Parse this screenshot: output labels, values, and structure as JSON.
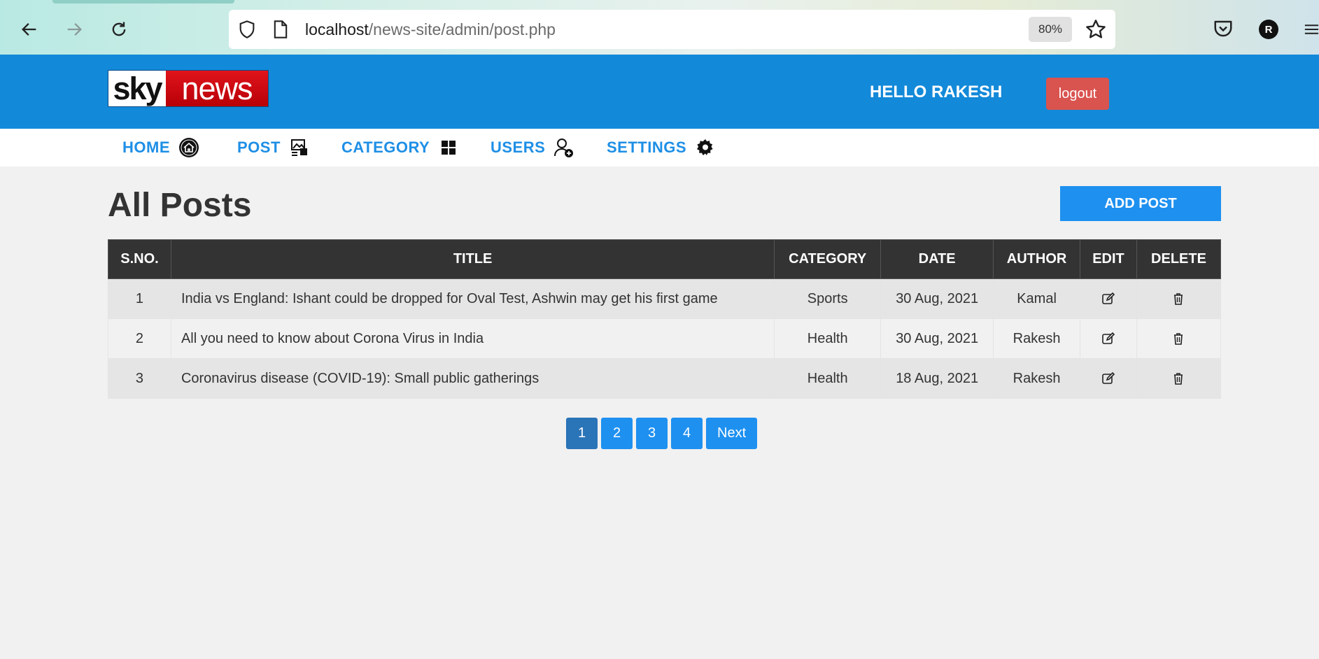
{
  "browser": {
    "url_host": "localhost",
    "url_path": "/news-site/admin/post.php",
    "zoom": "80%",
    "profile_initial": "R"
  },
  "header": {
    "logo_sky": "sky",
    "logo_news": "news",
    "greeting": "HELLO RAKESH",
    "logout_label": "logout"
  },
  "menu": {
    "items": [
      {
        "label": "HOME",
        "icon": "home-icon"
      },
      {
        "label": "POST",
        "icon": "post-icon"
      },
      {
        "label": "CATEGORY",
        "icon": "category-grid-icon"
      },
      {
        "label": "USERS",
        "icon": "user-add-icon"
      },
      {
        "label": "SETTINGS",
        "icon": "gear-icon"
      }
    ]
  },
  "main": {
    "title": "All Posts",
    "add_post_label": "ADD POST"
  },
  "table": {
    "headers": [
      "S.NO.",
      "TITLE",
      "CATEGORY",
      "DATE",
      "AUTHOR",
      "EDIT",
      "DELETE"
    ],
    "rows": [
      {
        "sno": "1",
        "title": "India vs England: Ishant could be dropped for Oval Test, Ashwin may get his first game",
        "category": "Sports",
        "date": "30 Aug, 2021",
        "author": "Kamal"
      },
      {
        "sno": "2",
        "title": "All you need to know about Corona Virus in India",
        "category": "Health",
        "date": "30 Aug, 2021",
        "author": "Rakesh"
      },
      {
        "sno": "3",
        "title": "Coronavirus disease (COVID-19): Small public gatherings",
        "category": "Health",
        "date": "18 Aug, 2021",
        "author": "Rakesh"
      }
    ]
  },
  "pagination": {
    "pages": [
      "1",
      "2",
      "3",
      "4"
    ],
    "current": "1",
    "next_label": "Next"
  },
  "colors": {
    "header_bg": "#1389d9",
    "accent": "#1e90f0",
    "logout": "#d9534f",
    "table_header": "#333333"
  }
}
